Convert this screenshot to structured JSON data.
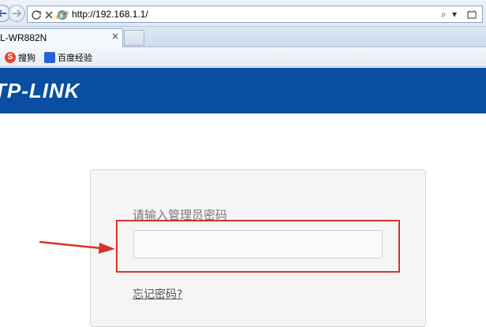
{
  "browser": {
    "url": "http://192.168.1.1/",
    "search_glyph": "⌕",
    "dropdown_glyph": "▾",
    "tab_title": "L-WR882N",
    "tab_close": "×",
    "favorites": [
      {
        "label": "搜狗",
        "icon": "sogou-icon"
      },
      {
        "label": "百度经验",
        "icon": "baidu-paw-icon"
      }
    ]
  },
  "router": {
    "brand": "TP-LINK",
    "header_color": "#0a4ea1"
  },
  "login": {
    "prompt": "请输入管理员密码",
    "password_value": "",
    "forgot_link": "忘记密码?",
    "highlight_color": "#d9312a"
  }
}
